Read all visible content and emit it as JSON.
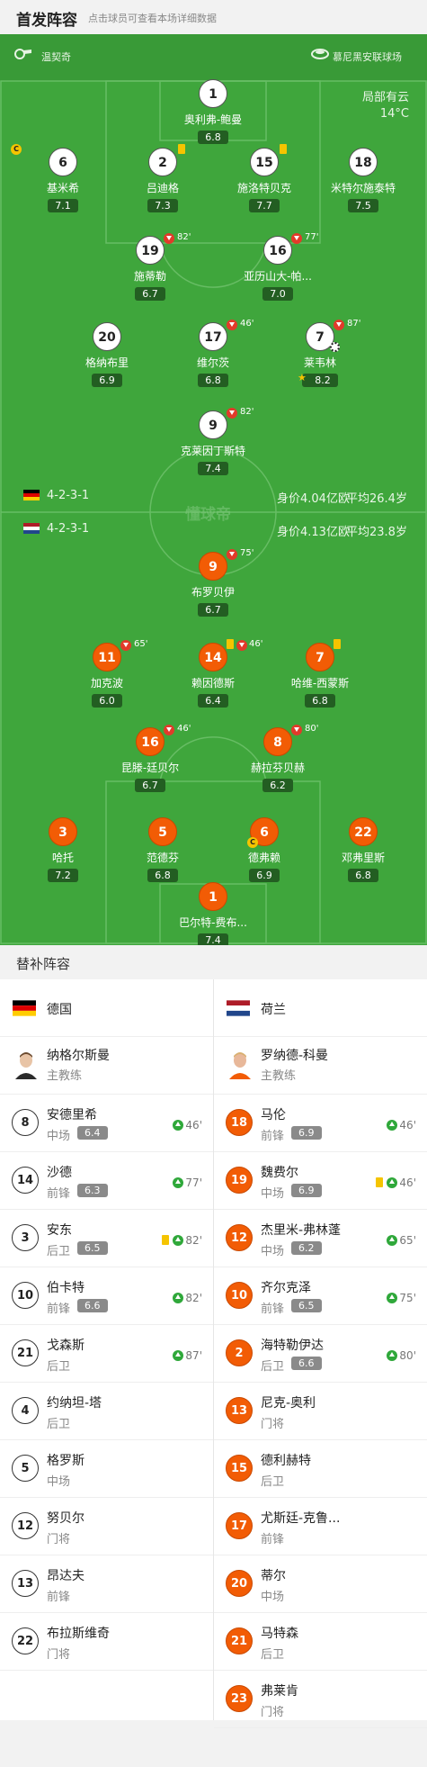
{
  "header": {
    "title": "首发阵容",
    "subtitle": "点击球员可查看本场详细数据"
  },
  "venue": {
    "referee": "温契奇",
    "stadium": "慕尼黑安联球场"
  },
  "weather": {
    "condition": "局部有云",
    "temp": "14°C"
  },
  "watermark": "懂球帝",
  "germany": {
    "formation": "4-2-3-1",
    "value": "身价4.04亿欧",
    "age": "平均26.4岁",
    "players": [
      {
        "num": "1",
        "name": "奥利弗-鲍曼",
        "rating": "6.8"
      },
      {
        "num": "6",
        "name": "基米希",
        "rating": "7.1",
        "captain": "C"
      },
      {
        "num": "2",
        "name": "吕迪格",
        "rating": "7.3"
      },
      {
        "num": "15",
        "name": "施洛特贝克",
        "rating": "7.7"
      },
      {
        "num": "18",
        "name": "米特尔施泰特",
        "rating": "7.5"
      },
      {
        "num": "19",
        "name": "施蒂勒",
        "rating": "6.7",
        "sub": "82'"
      },
      {
        "num": "16",
        "name": "亚历山大-帕...",
        "rating": "7.0",
        "sub": "77'"
      },
      {
        "num": "20",
        "name": "格纳布里",
        "rating": "6.9"
      },
      {
        "num": "17",
        "name": "维尔茨",
        "rating": "6.8",
        "sub": "46'"
      },
      {
        "num": "7",
        "name": "莱韦林",
        "rating": "8.2",
        "sub": "87'"
      },
      {
        "num": "9",
        "name": "克莱因丁斯特",
        "rating": "7.4",
        "sub": "82'"
      }
    ]
  },
  "netherlands": {
    "formation": "4-2-3-1",
    "value": "身价4.13亿欧",
    "age": "平均23.8岁",
    "players": [
      {
        "num": "9",
        "name": "布罗贝伊",
        "rating": "6.7",
        "sub": "75'"
      },
      {
        "num": "11",
        "name": "加克波",
        "rating": "6.0",
        "sub": "65'"
      },
      {
        "num": "14",
        "name": "赖因德斯",
        "rating": "6.4",
        "sub": "46'"
      },
      {
        "num": "7",
        "name": "哈维-西蒙斯",
        "rating": "6.8"
      },
      {
        "num": "16",
        "name": "昆滕-廷贝尔",
        "rating": "6.7",
        "sub": "46'"
      },
      {
        "num": "8",
        "name": "赫拉芬贝赫",
        "rating": "6.2",
        "sub": "80'"
      },
      {
        "num": "3",
        "name": "哈托",
        "rating": "7.2"
      },
      {
        "num": "5",
        "name": "范德芬",
        "rating": "6.8"
      },
      {
        "num": "6",
        "name": "德弗赖",
        "rating": "6.9",
        "captain": "C"
      },
      {
        "num": "22",
        "name": "邓弗里斯",
        "rating": "6.8"
      },
      {
        "num": "1",
        "name": "巴尔特-费布...",
        "rating": "7.4"
      }
    ]
  },
  "subs": {
    "title": "替补阵容",
    "left": {
      "team": "德国",
      "coach": {
        "name": "纳格尔斯曼",
        "role": "主教练"
      },
      "players": [
        {
          "num": "8",
          "name": "安德里希",
          "pos": "中场",
          "rating": "6.4",
          "time": "46'"
        },
        {
          "num": "14",
          "name": "沙德",
          "pos": "前锋",
          "rating": "6.3",
          "time": "77'"
        },
        {
          "num": "3",
          "name": "安东",
          "pos": "后卫",
          "rating": "6.5",
          "time": "82'",
          "card": "yellow"
        },
        {
          "num": "10",
          "name": "伯卡特",
          "pos": "前锋",
          "rating": "6.6",
          "time": "82'"
        },
        {
          "num": "21",
          "name": "戈森斯",
          "pos": "后卫",
          "time": "87'"
        },
        {
          "num": "4",
          "name": "约纳坦-塔",
          "pos": "后卫"
        },
        {
          "num": "5",
          "name": "格罗斯",
          "pos": "中场"
        },
        {
          "num": "12",
          "name": "努贝尔",
          "pos": "门将"
        },
        {
          "num": "13",
          "name": "昂达夫",
          "pos": "前锋"
        },
        {
          "num": "22",
          "name": "布拉斯维奇",
          "pos": "门将"
        }
      ]
    },
    "right": {
      "team": "荷兰",
      "coach": {
        "name": "罗纳德-科曼",
        "role": "主教练"
      },
      "players": [
        {
          "num": "18",
          "name": "马伦",
          "pos": "前锋",
          "rating": "6.9",
          "time": "46'"
        },
        {
          "num": "19",
          "name": "魏费尔",
          "pos": "中场",
          "rating": "6.9",
          "time": "46'",
          "card": "yellow"
        },
        {
          "num": "12",
          "name": "杰里米-弗林蓬",
          "pos": "中场",
          "rating": "6.2",
          "time": "65'"
        },
        {
          "num": "10",
          "name": "齐尔克泽",
          "pos": "前锋",
          "rating": "6.5",
          "time": "75'"
        },
        {
          "num": "2",
          "name": "海特勒伊达",
          "pos": "后卫",
          "rating": "6.6",
          "time": "80'"
        },
        {
          "num": "13",
          "name": "尼克-奥利",
          "pos": "门将"
        },
        {
          "num": "15",
          "name": "德利赫特",
          "pos": "后卫"
        },
        {
          "num": "17",
          "name": "尤斯廷-克鲁...",
          "pos": "前锋"
        },
        {
          "num": "20",
          "name": "蒂尔",
          "pos": "中场"
        },
        {
          "num": "21",
          "name": "马特森",
          "pos": "后卫"
        },
        {
          "num": "23",
          "name": "弗莱肯",
          "pos": "门将"
        }
      ]
    }
  }
}
